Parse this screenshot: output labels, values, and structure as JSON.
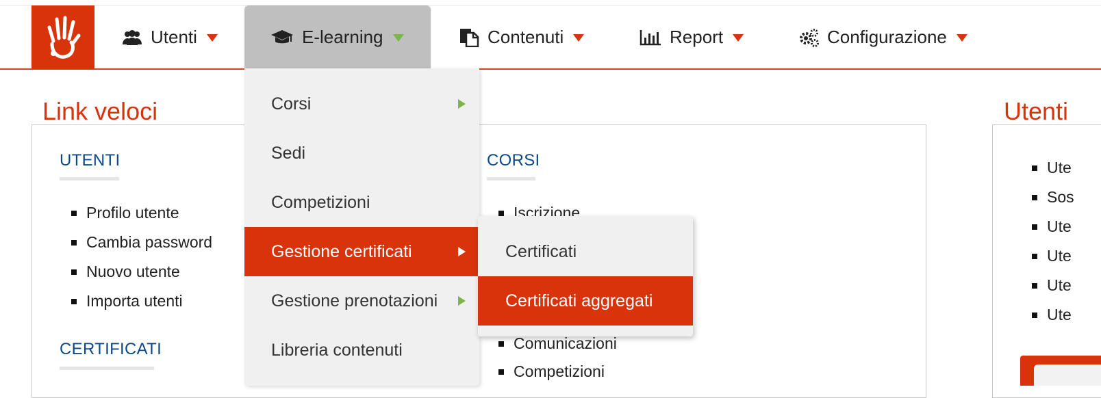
{
  "nav": {
    "items": [
      {
        "label": "Utenti",
        "icon": "users-icon"
      },
      {
        "label": "E-learning",
        "icon": "graduation-cap-icon"
      },
      {
        "label": "Contenuti",
        "icon": "documents-icon"
      },
      {
        "label": "Report",
        "icon": "bar-chart-icon"
      },
      {
        "label": "Configurazione",
        "icon": "gears-icon"
      }
    ],
    "accent": "#d9330c",
    "active_caret_color": "#7ab648"
  },
  "quick_links": {
    "title": "Link veloci",
    "utenti": {
      "heading": "UTENTI",
      "items": [
        "Profilo utente",
        "Cambia password",
        "Nuovo utente",
        "Importa utenti"
      ]
    },
    "certificati": {
      "heading": "CERTIFICATI"
    },
    "corsi": {
      "heading": "CORSI",
      "items": [
        "Iscrizione",
        "Comunicazioni",
        "Competizioni"
      ]
    }
  },
  "right_panel": {
    "title": "Utenti",
    "items": [
      "Ute",
      "Sos",
      "Ute",
      "Ute",
      "Ute",
      "Ute"
    ]
  },
  "dropdown": {
    "items": [
      {
        "label": "Corsi",
        "has_submenu": true
      },
      {
        "label": "Sedi",
        "has_submenu": false
      },
      {
        "label": "Competizioni",
        "has_submenu": false
      },
      {
        "label": "Gestione certificati",
        "has_submenu": true,
        "active": true
      },
      {
        "label": "Gestione prenotazioni",
        "has_submenu": true
      },
      {
        "label": "Libreria contenuti",
        "has_submenu": false
      }
    ]
  },
  "submenu": {
    "items": [
      {
        "label": "Certificati"
      },
      {
        "label": "Certificati aggregati",
        "active": true
      }
    ]
  }
}
